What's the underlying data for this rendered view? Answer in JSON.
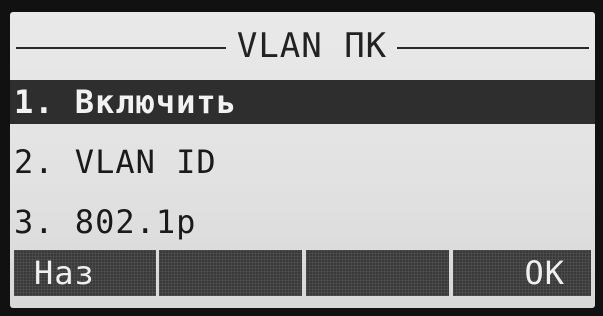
{
  "title": "VLAN ПК",
  "menu": {
    "items": [
      {
        "label": "1. Включить",
        "selected": true
      },
      {
        "label": "2. VLAN ID",
        "selected": false
      },
      {
        "label": "3. 802.1p",
        "selected": false
      }
    ]
  },
  "softkeys": {
    "back_label": "Наз",
    "empty_2": "",
    "empty_3": "",
    "ok_label": "OK"
  },
  "colors": {
    "screen_bg": "#e5e5e5",
    "highlight_bg": "#2e2e2e",
    "softkey_bg": "#3a3a3a",
    "bezel": "#111111"
  }
}
